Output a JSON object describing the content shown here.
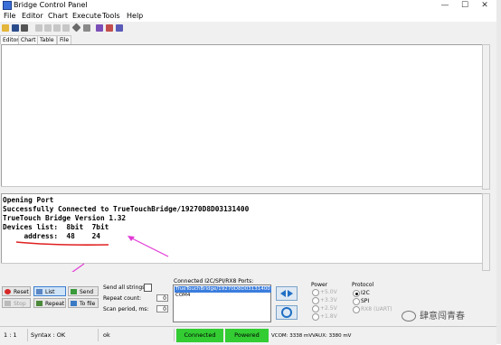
{
  "window": {
    "title": "Bridge Control Panel",
    "controls": [
      "—",
      "☐",
      "✕"
    ]
  },
  "menu": [
    "File",
    "Editor",
    "Chart",
    "Execute",
    "Tools",
    "Help"
  ],
  "tabs": [
    "Editor",
    "Chart",
    "Table",
    "File"
  ],
  "console_lines": [
    "Opening Port",
    "Successfully Connected to TrueTouchBridge/19270D8D03131400",
    "TrueTouch Bridge Version 1.32",
    "Devices list:  8bit  7bit",
    "     address:  48    24"
  ],
  "buttons": {
    "reset": "Reset",
    "list": "List",
    "send": "Send",
    "stop": "Stop",
    "repeat": "Repeat",
    "to_file": "To file"
  },
  "options": {
    "send_all_strings": "Send all strings:",
    "repeat_count_label": "Repeat count:",
    "repeat_count_value": "0",
    "scan_period_label": "Scan period, ms:",
    "scan_period_value": "0"
  },
  "ports": {
    "label": "Connected I2C/SPI/RX8 Ports:",
    "items": [
      "TrueTouchBridge/19270D8D03131400",
      "COM4"
    ],
    "selected_index": 0
  },
  "power": {
    "label": "Power",
    "options": [
      "+5.0V",
      "+3.3V",
      "+2.5V",
      "+1.8V"
    ]
  },
  "protocol": {
    "label": "Protocol",
    "options": [
      "I2C",
      "SPI",
      "RX8 (UART)"
    ],
    "selected": "I2C"
  },
  "status": {
    "position": "1 : 1",
    "syntax": "Syntax : OK",
    "message": "ok",
    "connected": "Connected",
    "powered": "Powered",
    "vcom": "VCOM: 3338 mV",
    "vaux": "VAUX: 3380 mV"
  },
  "watermark": "肆意闯青春",
  "colors": {
    "green_status": "#33cc33",
    "annotation": "#e23ad6",
    "underline": "#e02020",
    "selection": "#3b7ddd"
  }
}
